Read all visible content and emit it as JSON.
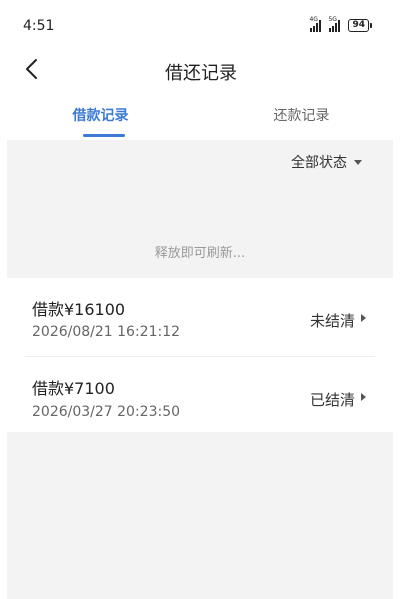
{
  "status_bar": {
    "time": "4:51",
    "signal1_label": "4G",
    "signal2_label": "5G",
    "battery": "94"
  },
  "nav": {
    "title": "借还记录"
  },
  "tabs": [
    {
      "label": "借款记录",
      "active": true
    },
    {
      "label": "还款记录",
      "active": false
    }
  ],
  "filter": {
    "label": "全部状态"
  },
  "refresh_hint": "释放即可刷新...",
  "records": [
    {
      "amount": "借款¥16100",
      "date": "2026/08/21 16:21:12",
      "status": "未结清"
    },
    {
      "amount": "借款¥7100",
      "date": "2026/03/27 20:23:50",
      "status": "已结清"
    }
  ],
  "colors": {
    "accent": "#3d7ad6",
    "background_gray": "#f3f3f3"
  },
  "icons": {
    "back": "chevron-left-icon",
    "filter_dropdown": "triangle-down-icon",
    "row_arrow": "triangle-right-icon"
  }
}
